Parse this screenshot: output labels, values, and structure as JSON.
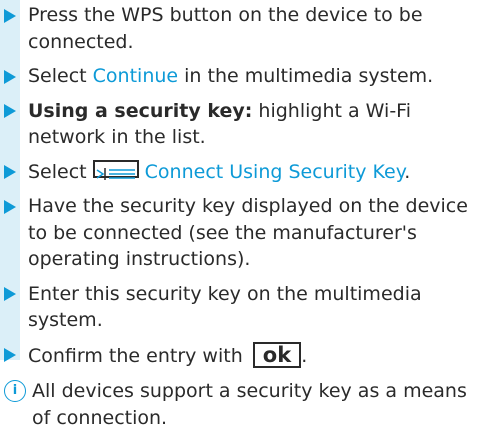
{
  "steps": [
    {
      "text": "Press the WPS button on the device to be connected."
    },
    {
      "before": "Select ",
      "link": "Continue",
      "after": " in the multimedia system."
    },
    {
      "bold": "Using a security key:",
      "after": " highlight a Wi-Fi network in the list."
    },
    {
      "before": "Select ",
      "icon": "menu-list-icon",
      "link": "Connect Using Security Key",
      "after": "."
    },
    {
      "text": "Have the security key displayed on the device to be connected (see the manufacturer's operating instructions)."
    },
    {
      "text": "Enter this security key on the multimedia system."
    },
    {
      "before": "Confirm the entry with ",
      "button": "ok",
      "after": "."
    }
  ],
  "note": {
    "icon": "info-icon",
    "text": "All devices support a security key as a means of connection."
  },
  "colors": {
    "accent": "#0d9ad7",
    "rail": "#dbeff8",
    "text": "#2a2a2a"
  }
}
